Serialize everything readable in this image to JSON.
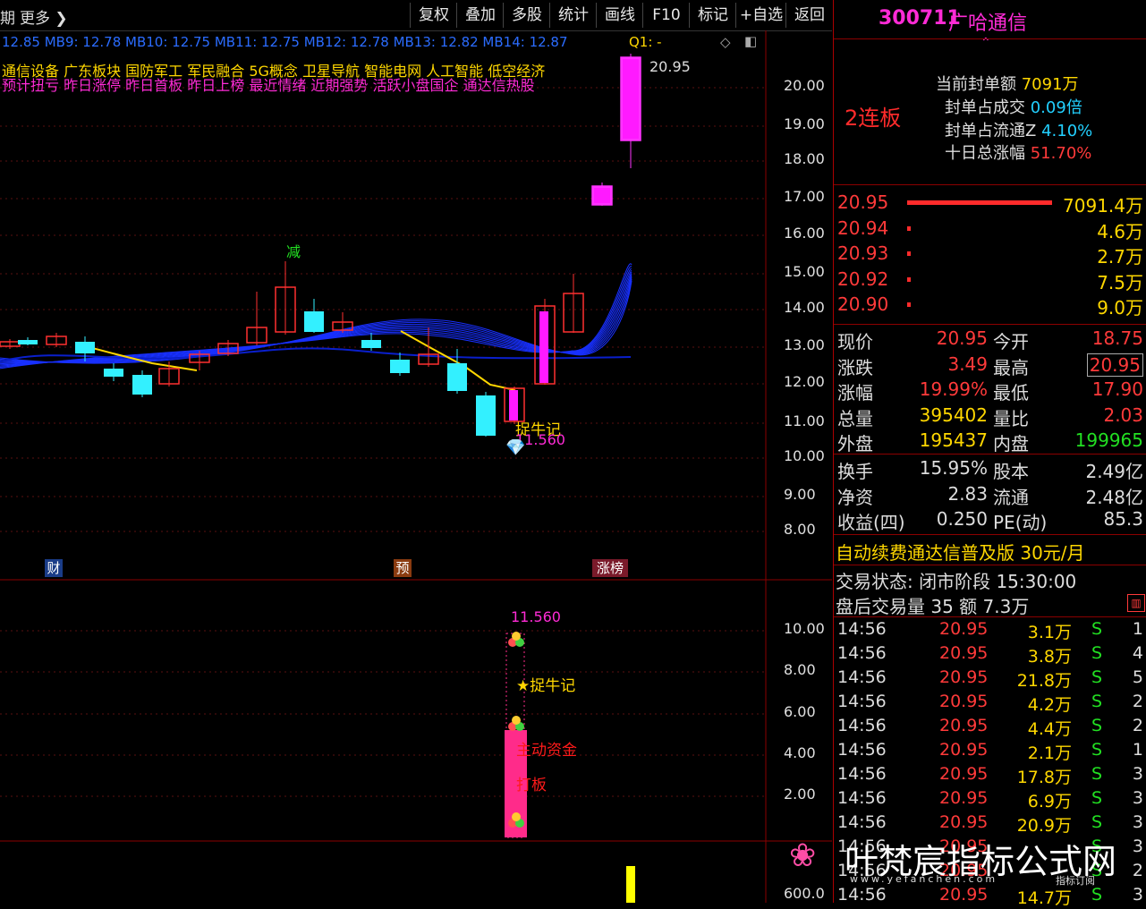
{
  "toolbar": {
    "left_label": "期",
    "more_label": "更多",
    "buttons": [
      "复权",
      "叠加",
      "多股",
      "统计",
      "画线",
      "F10",
      "标记",
      "+自选",
      "返回"
    ]
  },
  "ma_line": "12.85 MB9: 12.78 MB10: 12.75 MB11: 12.75 MB12: 12.78 MB13: 12.82 MB14: 12.87",
  "q_label": "Q1: -",
  "concept_tags": "通信设备  广东板块  国防军工 军民融合 5G概念 卫星导航 智能电网 人工智能 低空经济",
  "signal_tags": "预计扭亏 昨日涨停 昨日首板 昨日上榜 最近情绪 近期强势 活跃小盘国企 通达信热股",
  "chart_annotations": {
    "high_label": "20.95",
    "jian_label": "减",
    "zhuoniu_label": "捉牛记",
    "low_label": "11.560",
    "markers": [
      "财",
      "预",
      "涨榜"
    ]
  },
  "chart_data": {
    "type": "candlestick",
    "price_axis": [
      "20.00",
      "19.00",
      "18.00",
      "17.00",
      "16.00",
      "15.00",
      "14.00",
      "13.00",
      "12.00",
      "11.00",
      "10.00",
      "9.00",
      "8.00"
    ],
    "ylim": [
      7.6,
      21.0
    ]
  },
  "sub_chart": {
    "axis": [
      "10.00",
      "8.00",
      "6.00",
      "4.00",
      "2.00"
    ],
    "top_label": "11.560",
    "zhuoniu_label": "★捉牛记",
    "zhudong_label": "主动资金",
    "daban_label": "打板"
  },
  "vol_axis": "600.0",
  "stock": {
    "code": "300711",
    "name": "广哈通信",
    "lianban": "2连板",
    "seal_amount_label": "当前封单额",
    "seal_amount": "7091万",
    "seal_vs_deal_label": "封单占成交",
    "seal_vs_deal": "0.09倍",
    "seal_vs_float_label": "封单占流通Z",
    "seal_vs_float": "4.10%",
    "ten_day_label": "十日总涨幅",
    "ten_day": "51.70%"
  },
  "bids": [
    {
      "price": "20.95",
      "vol": "7091.4万",
      "bar": 1.0
    },
    {
      "price": "20.94",
      "vol": "4.6万",
      "bar": 0.0
    },
    {
      "price": "20.93",
      "vol": "2.7万",
      "bar": 0.0
    },
    {
      "price": "20.92",
      "vol": "7.5万",
      "bar": 0.0
    },
    {
      "price": "20.90",
      "vol": "9.0万",
      "bar": 0.0
    }
  ],
  "quote": [
    {
      "l1": "现价",
      "v1": "20.95",
      "l2": "今开",
      "v2": "18.75"
    },
    {
      "l1": "涨跌",
      "v1": "3.49",
      "l2": "最高",
      "v2": "20.95"
    },
    {
      "l1": "涨幅",
      "v1": "19.99%",
      "l2": "最低",
      "v2": "17.90"
    },
    {
      "l1": "总量",
      "v1": "395402",
      "l2": "量比",
      "v2": "2.03"
    },
    {
      "l1": "外盘",
      "v1": "195437",
      "l2": "内盘",
      "v2": "199965"
    }
  ],
  "finance": [
    {
      "l1": "换手",
      "v1": "15.95%",
      "l2": "股本",
      "v2": "2.49亿"
    },
    {
      "l1": "净资",
      "v1": "2.83",
      "l2": "流通",
      "v2": "2.48亿"
    },
    {
      "l1": "收益(四)",
      "v1": "0.250",
      "l2": "PE(动)",
      "v2": "85.3"
    }
  ],
  "promo": "自动续费通达信普及版  30元/月",
  "trade_status": "交易状态: 闭市阶段 15:30:00",
  "after_hours": "盘后交易量 35 额 7.3万",
  "ticks": [
    {
      "t": "14:56",
      "p": "20.95",
      "v": "3.1万",
      "s": "S",
      "n": "1"
    },
    {
      "t": "14:56",
      "p": "20.95",
      "v": "3.8万",
      "s": "S",
      "n": "4"
    },
    {
      "t": "14:56",
      "p": "20.95",
      "v": "21.8万",
      "s": "S",
      "n": "5"
    },
    {
      "t": "14:56",
      "p": "20.95",
      "v": "4.2万",
      "s": "S",
      "n": "2"
    },
    {
      "t": "14:56",
      "p": "20.95",
      "v": "4.4万",
      "s": "S",
      "n": "2"
    },
    {
      "t": "14:56",
      "p": "20.95",
      "v": "2.1万",
      "s": "S",
      "n": "1"
    },
    {
      "t": "14:56",
      "p": "20.95",
      "v": "17.8万",
      "s": "S",
      "n": "3"
    },
    {
      "t": "14:56",
      "p": "20.95",
      "v": "6.9万",
      "s": "S",
      "n": "3"
    },
    {
      "t": "14:56",
      "p": "20.95",
      "v": "20.9万",
      "s": "S",
      "n": "3"
    },
    {
      "t": "14:56",
      "p": "20.95",
      "v": "",
      "s": "S",
      "n": "3"
    },
    {
      "t": "14:56",
      "p": "20.95",
      "v": "",
      "s": "S",
      "n": "2"
    },
    {
      "t": "14:56",
      "p": "20.95",
      "v": "14.7万",
      "s": "S",
      "n": "3"
    }
  ],
  "watermark": {
    "title": "叶梵宸指标公式网",
    "url": "www.yefanchen.com",
    "sub": "指标订阅"
  }
}
